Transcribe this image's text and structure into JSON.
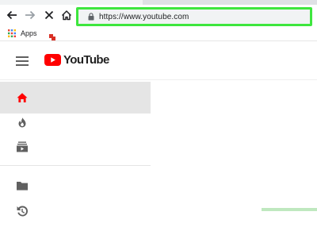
{
  "browser": {
    "url": "https://www.youtube.com",
    "bookmarks": [
      {
        "label": "Apps"
      }
    ]
  },
  "youtube": {
    "logo_text": "YouTube",
    "brand_color": "#ff0000"
  },
  "sidebar": {
    "items": [
      {
        "icon": "home-icon",
        "active": true
      },
      {
        "icon": "trending-fire-icon",
        "active": false
      },
      {
        "icon": "subscriptions-icon",
        "active": false
      },
      {
        "icon": "library-folder-icon",
        "active": false
      },
      {
        "icon": "history-icon",
        "active": false
      }
    ]
  },
  "colors": {
    "highlight_border": "#3ee63e",
    "active_item_bg": "#e5e5e5"
  }
}
